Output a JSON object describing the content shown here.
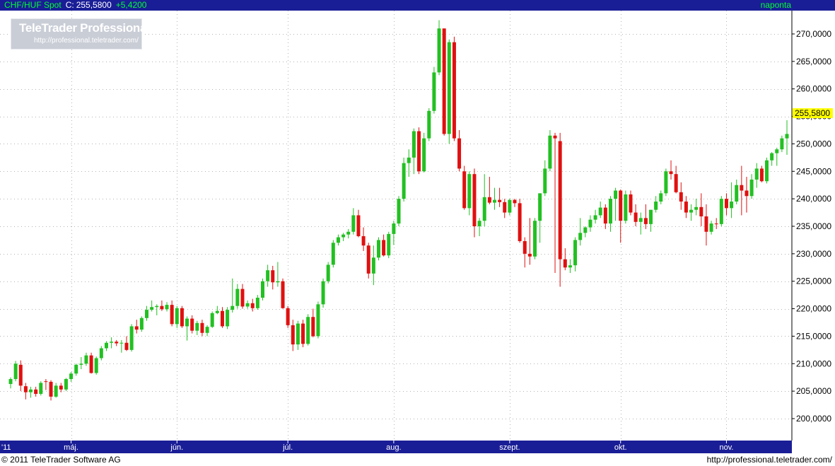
{
  "header": {
    "symbol": "CHF/HUF Spot",
    "close_label": "C:",
    "close_value": "255,5800",
    "change": "+5,4200",
    "period": "naponta"
  },
  "logo": {
    "brand": "TeleTrader Professional",
    "url": "http://professional.teletrader.com/"
  },
  "footer": {
    "copyright": "© 2011  TeleTrader Software AG",
    "url": "http://professional.teletrader.com/"
  },
  "colors": {
    "title_bar": "#1a1e96",
    "axis_bar": "#1a1e96",
    "up": "#22c022",
    "down": "#e01010",
    "grid": "#b4b4b4",
    "last_price_bg": "#ffff00"
  },
  "chart_data": {
    "type": "candlestick",
    "y_axis": {
      "range": [
        195,
        275
      ],
      "ticks": [
        {
          "value": 200,
          "label": "200,0000"
        },
        {
          "value": 205,
          "label": "205,0000"
        },
        {
          "value": 210,
          "label": "210,0000"
        },
        {
          "value": 215,
          "label": "215,0000"
        },
        {
          "value": 220,
          "label": "220,0000"
        },
        {
          "value": 225,
          "label": "225,0000"
        },
        {
          "value": 230,
          "label": "230,0000"
        },
        {
          "value": 235,
          "label": "235,0000"
        },
        {
          "value": 240,
          "label": "240,0000"
        },
        {
          "value": 245,
          "label": "245,0000"
        },
        {
          "value": 250,
          "label": "250,0000"
        },
        {
          "value": 255,
          "label": "255,0000"
        },
        {
          "value": 260,
          "label": "260,0000"
        },
        {
          "value": 265,
          "label": "265,0000"
        },
        {
          "value": 270,
          "label": "270,0000"
        }
      ]
    },
    "x_axis": {
      "labels": [
        {
          "label": "'11",
          "index": -1
        },
        {
          "label": "máj.",
          "index": 12
        },
        {
          "label": "jún.",
          "index": 33
        },
        {
          "label": "júl.",
          "index": 55
        },
        {
          "label": "aug.",
          "index": 76
        },
        {
          "label": "szept.",
          "index": 99
        },
        {
          "label": "okt.",
          "index": 121
        },
        {
          "label": "nov.",
          "index": 142
        }
      ]
    },
    "last_price": {
      "value": 255.58,
      "label": "255,5800"
    },
    "candles": [
      [
        206.3,
        207.5,
        205.5,
        207.2
      ],
      [
        207.2,
        210.5,
        206.8,
        210.0
      ],
      [
        209.8,
        210.6,
        205.0,
        206.0
      ],
      [
        205.9,
        206.5,
        203.5,
        204.8
      ],
      [
        204.8,
        205.8,
        203.8,
        205.3
      ],
      [
        205.3,
        205.8,
        204.0,
        204.5
      ],
      [
        204.5,
        206.8,
        204.2,
        206.5
      ],
      [
        206.8,
        207.2,
        205.2,
        206.7
      ],
      [
        206.7,
        207.0,
        203.3,
        204.0
      ],
      [
        204.0,
        206.5,
        203.8,
        206.0
      ],
      [
        206.0,
        206.5,
        204.8,
        205.3
      ],
      [
        205.3,
        207.4,
        205.0,
        207.2
      ],
      [
        207.2,
        208.5,
        206.7,
        208.2
      ],
      [
        208.2,
        210.0,
        207.8,
        209.8
      ],
      [
        209.8,
        211.2,
        209.0,
        210.0
      ],
      [
        210.0,
        212.0,
        209.6,
        211.5
      ],
      [
        211.5,
        212.0,
        208.2,
        208.3
      ],
      [
        208.3,
        211.3,
        208.0,
        211.0
      ],
      [
        211.0,
        213.2,
        210.6,
        212.8
      ],
      [
        212.8,
        214.1,
        212.3,
        213.8
      ],
      [
        213.8,
        214.8,
        212.8,
        214.0
      ],
      [
        214.0,
        214.3,
        213.2,
        213.7
      ],
      [
        213.7,
        214.3,
        212.0,
        213.8
      ],
      [
        213.8,
        215.0,
        212.3,
        212.5
      ],
      [
        212.5,
        217.2,
        212.2,
        216.8
      ],
      [
        216.8,
        218.0,
        215.5,
        216.2
      ],
      [
        216.2,
        218.6,
        215.8,
        218.3
      ],
      [
        218.3,
        220.5,
        217.8,
        219.8
      ],
      [
        219.8,
        221.5,
        219.5,
        220.3
      ],
      [
        220.3,
        220.8,
        218.8,
        220.5
      ],
      [
        220.5,
        221.5,
        219.6,
        219.9
      ],
      [
        219.9,
        221.2,
        219.5,
        220.7
      ],
      [
        220.7,
        221.5,
        216.8,
        217.2
      ],
      [
        217.2,
        220.5,
        216.5,
        220.1
      ],
      [
        220.1,
        220.5,
        216.5,
        216.8
      ],
      [
        216.8,
        218.6,
        214.2,
        218.2
      ],
      [
        218.2,
        218.8,
        215.5,
        216.0
      ],
      [
        216.0,
        217.8,
        215.2,
        217.4
      ],
      [
        217.4,
        218.0,
        215.0,
        215.6
      ],
      [
        215.6,
        217.0,
        215.0,
        216.7
      ],
      [
        216.7,
        219.5,
        216.5,
        219.2
      ],
      [
        219.2,
        220.5,
        219.0,
        219.6
      ],
      [
        219.6,
        220.3,
        216.5,
        216.8
      ],
      [
        216.8,
        220.3,
        216.3,
        219.8
      ],
      [
        219.8,
        225.5,
        219.3,
        220.5
      ],
      [
        220.5,
        224.5,
        220.0,
        223.6
      ],
      [
        223.6,
        224.5,
        220.0,
        220.4
      ],
      [
        220.4,
        221.5,
        220.0,
        221.0
      ],
      [
        221.0,
        221.8,
        219.5,
        220.1
      ],
      [
        220.1,
        222.5,
        219.8,
        222.0
      ],
      [
        222.0,
        225.5,
        221.5,
        225.0
      ],
      [
        225.0,
        228.0,
        224.0,
        227.0
      ],
      [
        227.0,
        227.8,
        223.5,
        224.8
      ],
      [
        224.8,
        228.5,
        224.0,
        225.0
      ],
      [
        225.0,
        225.5,
        220.0,
        220.1
      ],
      [
        220.1,
        220.5,
        216.5,
        217.0
      ],
      [
        217.0,
        218.0,
        212.3,
        213.5
      ],
      [
        213.5,
        217.8,
        212.5,
        217.3
      ],
      [
        217.3,
        218.0,
        213.0,
        213.6
      ],
      [
        213.6,
        219.0,
        213.3,
        218.5
      ],
      [
        218.5,
        220.0,
        214.8,
        215.0
      ],
      [
        215.0,
        221.3,
        214.6,
        220.8
      ],
      [
        220.8,
        225.5,
        220.2,
        225.0
      ],
      [
        225.0,
        228.5,
        224.6,
        228.0
      ],
      [
        228.0,
        232.5,
        227.5,
        232.0
      ],
      [
        232.0,
        233.5,
        231.5,
        233.0
      ],
      [
        233.0,
        233.8,
        232.3,
        233.5
      ],
      [
        233.5,
        234.5,
        232.8,
        234.0
      ],
      [
        234.0,
        238.3,
        233.5,
        237.0
      ],
      [
        237.0,
        238.0,
        233.0,
        233.2
      ],
      [
        233.2,
        234.8,
        230.5,
        231.5
      ],
      [
        231.5,
        232.0,
        225.5,
        226.4
      ],
      [
        226.4,
        231.5,
        224.3,
        229.3
      ],
      [
        229.3,
        233.0,
        228.8,
        232.5
      ],
      [
        232.5,
        233.5,
        229.5,
        229.7
      ],
      [
        229.7,
        234.0,
        229.2,
        233.6
      ],
      [
        233.6,
        236.0,
        231.6,
        235.5
      ],
      [
        235.5,
        240.5,
        235.0,
        240.0
      ],
      [
        240.0,
        247.5,
        239.5,
        246.5
      ],
      [
        246.5,
        249.0,
        244.0,
        247.5
      ],
      [
        247.5,
        252.8,
        244.5,
        252.3
      ],
      [
        252.3,
        253.0,
        244.5,
        245.0
      ],
      [
        245.0,
        252.0,
        244.8,
        251.0
      ],
      [
        251.0,
        256.5,
        250.5,
        256.0
      ],
      [
        256.0,
        264.0,
        255.5,
        263.0
      ],
      [
        263.0,
        272.5,
        262.5,
        271.0
      ],
      [
        271.0,
        269.5,
        251.5,
        251.8
      ],
      [
        251.8,
        269.0,
        250.0,
        268.5
      ],
      [
        268.5,
        269.5,
        250.5,
        251.0
      ],
      [
        251.0,
        252.5,
        245.0,
        245.5
      ],
      [
        245.0,
        246.0,
        238.0,
        238.3
      ],
      [
        238.3,
        245.0,
        237.0,
        244.5
      ],
      [
        244.5,
        245.5,
        233.0,
        235.0
      ],
      [
        235.0,
        236.5,
        233.2,
        236.0
      ],
      [
        236.0,
        244.5,
        235.0,
        240.3
      ],
      [
        240.3,
        244.0,
        239.0,
        239.3
      ],
      [
        239.3,
        242.0,
        238.0,
        239.8
      ],
      [
        239.8,
        242.0,
        238.5,
        239.4
      ],
      [
        239.4,
        240.0,
        236.5,
        237.5
      ],
      [
        237.5,
        240.0,
        237.0,
        239.8
      ],
      [
        239.8,
        240.0,
        238.5,
        239.2
      ],
      [
        239.2,
        240.0,
        232.0,
        232.3
      ],
      [
        232.3,
        233.0,
        227.5,
        230.0
      ],
      [
        230.0,
        236.5,
        228.0,
        229.5
      ],
      [
        229.5,
        236.5,
        229.0,
        236.0
      ],
      [
        236.0,
        241.0,
        232.0,
        241.0
      ],
      [
        241.0,
        247.0,
        240.5,
        245.5
      ],
      [
        245.5,
        252.5,
        245.0,
        251.5
      ],
      [
        251.5,
        252.0,
        226.5,
        251.0
      ],
      [
        250.5,
        252.0,
        224.0,
        229.0
      ],
      [
        229.0,
        231.0,
        227.0,
        227.5
      ],
      [
        227.5,
        229.0,
        226.5,
        227.9
      ],
      [
        227.9,
        233.0,
        226.8,
        232.5
      ],
      [
        232.5,
        236.5,
        231.5,
        233.8
      ],
      [
        233.8,
        235.0,
        233.0,
        234.8
      ],
      [
        234.8,
        237.0,
        234.0,
        236.2
      ],
      [
        236.2,
        238.0,
        235.5,
        237.0
      ],
      [
        237.0,
        239.5,
        236.5,
        238.4
      ],
      [
        238.4,
        239.0,
        234.5,
        235.5
      ],
      [
        235.5,
        240.5,
        234.0,
        240.0
      ],
      [
        240.0,
        242.0,
        236.0,
        241.5
      ],
      [
        241.5,
        241.7,
        232.0,
        236.0
      ],
      [
        236.0,
        241.5,
        235.5,
        240.8
      ],
      [
        240.8,
        241.5,
        237.0,
        237.5
      ],
      [
        237.5,
        239.0,
        235.0,
        235.8
      ],
      [
        235.8,
        237.5,
        233.5,
        236.5
      ],
      [
        236.5,
        239.0,
        234.5,
        235.4
      ],
      [
        235.4,
        236.5,
        234.0,
        238.0
      ],
      [
        238.0,
        240.5,
        237.5,
        239.5
      ],
      [
        239.5,
        241.5,
        239.0,
        241.0
      ],
      [
        241.0,
        245.5,
        240.5,
        245.0
      ],
      [
        245.0,
        247.0,
        243.5,
        244.5
      ],
      [
        244.5,
        246.0,
        241.0,
        241.2
      ],
      [
        241.2,
        243.0,
        238.0,
        239.5
      ],
      [
        239.5,
        240.5,
        236.5,
        237.5
      ],
      [
        237.5,
        239.0,
        236.0,
        238.0
      ],
      [
        238.0,
        240.0,
        237.0,
        238.5
      ],
      [
        238.5,
        241.0,
        235.0,
        236.8
      ],
      [
        236.8,
        239.0,
        231.5,
        234.0
      ],
      [
        234.0,
        236.0,
        233.5,
        235.5
      ],
      [
        235.5,
        236.5,
        234.5,
        235.4
      ],
      [
        235.4,
        240.5,
        235.0,
        240.0
      ],
      [
        240.0,
        241.0,
        237.0,
        238.3
      ],
      [
        238.3,
        243.0,
        236.5,
        239.5
      ],
      [
        239.5,
        243.5,
        239.0,
        242.5
      ],
      [
        242.5,
        246.0,
        237.0,
        241.5
      ],
      [
        241.5,
        244.0,
        237.5,
        240.5
      ],
      [
        240.5,
        244.5,
        240.0,
        243.5
      ],
      [
        243.5,
        246.5,
        242.0,
        245.5
      ],
      [
        245.5,
        246.0,
        243.0,
        243.2
      ],
      [
        243.2,
        247.5,
        242.8,
        247.0
      ],
      [
        247.0,
        248.5,
        246.0,
        248.3
      ],
      [
        248.3,
        249.3,
        246.0,
        249.0
      ],
      [
        249.0,
        251.5,
        248.5,
        251.0
      ],
      [
        251.0,
        254.3,
        248.0,
        251.8
      ]
    ]
  }
}
